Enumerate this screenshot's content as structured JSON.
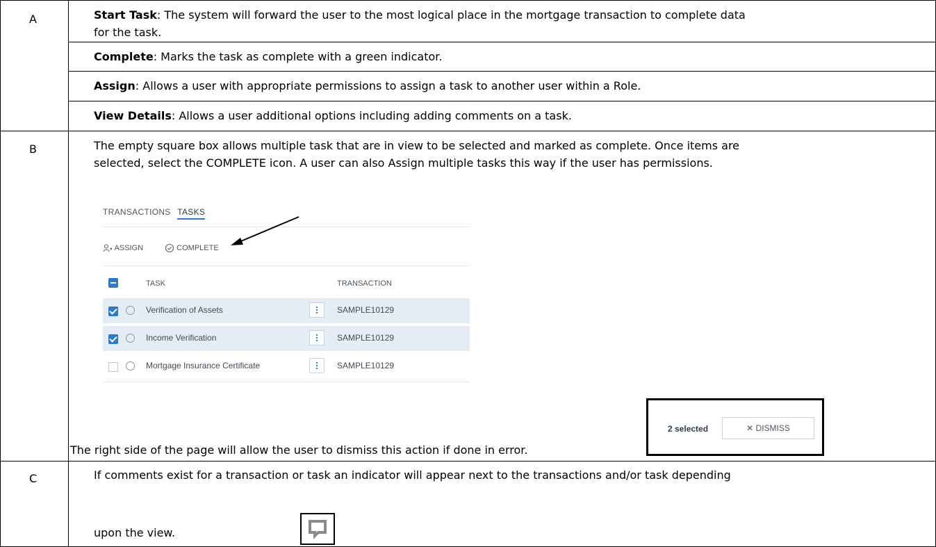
{
  "rows": [
    {
      "letter": "A",
      "items": [
        {
          "term": "Start Task",
          "text": ": The system will forward the user to the most logical place in the mortgage transaction to complete data",
          "text2": "for the task."
        },
        {
          "term": "Complete",
          "text": ": Marks the task as complete with a green indicator."
        },
        {
          "term": "Assign",
          "text": ": Allows a user with appropriate permissions to assign a task to another user within a Role."
        },
        {
          "term": "View Details",
          "text": ": Allows a user additional options including adding comments on a task."
        }
      ]
    },
    {
      "letter": "B",
      "line1": "The empty square box allows multiple task that are in view to be selected and marked as complete. Once items are",
      "line2": "selected, select the COMPLETE icon. A user can also Assign multiple tasks this way if the user has permissions.",
      "note": "The right side of the page will allow the user to dismiss this action if done in error."
    },
    {
      "letter": "C",
      "line1": "If comments exist for a transaction or task an indicator will appear next to the transactions and/or task depending",
      "line2": "upon the view."
    }
  ],
  "screenshot": {
    "tabs": [
      "TRANSACTIONS",
      "TASKS"
    ],
    "toolbar": {
      "assign": "ASSIGN",
      "complete": "COMPLETE"
    },
    "columns": {
      "task": "TASK",
      "transaction": "TRANSACTION"
    },
    "tasks": [
      {
        "name": "Verification of Assets",
        "transaction": "SAMPLE10129",
        "checked": true
      },
      {
        "name": "Income Verification",
        "transaction": "SAMPLE10129",
        "checked": true
      },
      {
        "name": "Mortgage Insurance Certificate",
        "transaction": "SAMPLE10129",
        "checked": false
      }
    ],
    "selected_count": "2 selected",
    "dismiss": "DISMISS"
  }
}
